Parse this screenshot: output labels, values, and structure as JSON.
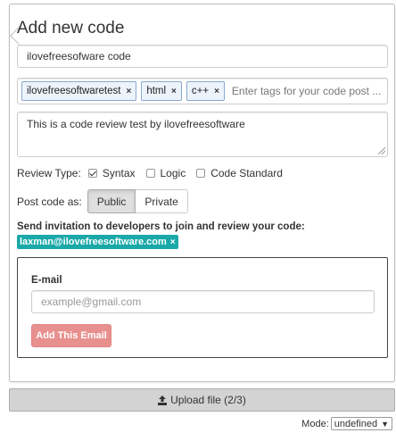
{
  "form": {
    "title": "Add new code",
    "code_name_value": "ilovefreesofware code",
    "tags": [
      {
        "label": "ilovefreesoftwaretest"
      },
      {
        "label": "html"
      },
      {
        "label": "c++"
      }
    ],
    "tag_remove_glyph": "×",
    "tags_placeholder": "Enter tags for your code post ...",
    "description_value": "This is a code review test by ilovefreesoftware",
    "review_type_label": "Review Type:",
    "review_options": [
      {
        "label": "Syntax",
        "checked": true
      },
      {
        "label": "Logic",
        "checked": false
      },
      {
        "label": "Code Standard",
        "checked": false
      }
    ],
    "post_as_label": "Post code as:",
    "post_as_options": [
      "Public",
      "Private"
    ],
    "post_as_selected": "Public",
    "invite_title": "Send invitation to developers to join and review your code:",
    "invited_email": "laxman@ilovefreesoftware.com",
    "email_label": "E-mail",
    "email_placeholder": "example@gmail.com",
    "add_email_button": "Add This Email"
  },
  "upload": {
    "label": "Upload file (2/3)",
    "icon": "upload-icon"
  },
  "mode": {
    "label": "Mode:",
    "value": "undefined"
  },
  "colors": {
    "invited_chip_bg": "#1aa8a8",
    "add_email_bg": "#e8908e",
    "tag_border": "#8aa8cf",
    "upload_bg": "#d3d3d3"
  }
}
